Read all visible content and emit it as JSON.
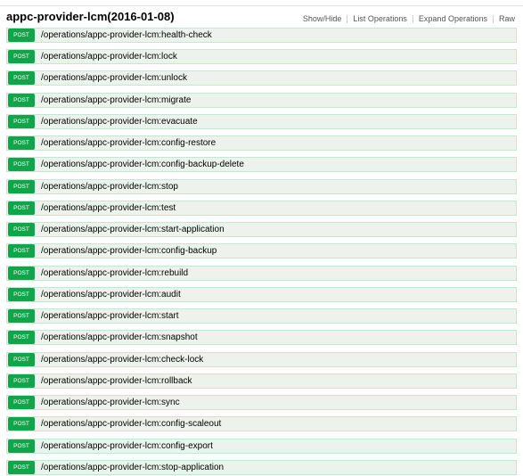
{
  "title": "appc-provider-lcm(2016-01-08)",
  "header_links": [
    "Show/Hide",
    "List Operations",
    "Expand Operations",
    "Raw"
  ],
  "colors": {
    "method_badge": "#10a54a",
    "row_background": "#ebf3ec",
    "row_border": "#c3e8d1"
  },
  "operations": [
    {
      "method": "POST",
      "path": "/operations/appc-provider-lcm:health-check"
    },
    {
      "method": "POST",
      "path": "/operations/appc-provider-lcm:lock"
    },
    {
      "method": "POST",
      "path": "/operations/appc-provider-lcm:unlock"
    },
    {
      "method": "POST",
      "path": "/operations/appc-provider-lcm:migrate"
    },
    {
      "method": "POST",
      "path": "/operations/appc-provider-lcm:evacuate"
    },
    {
      "method": "POST",
      "path": "/operations/appc-provider-lcm:config-restore"
    },
    {
      "method": "POST",
      "path": "/operations/appc-provider-lcm:config-backup-delete"
    },
    {
      "method": "POST",
      "path": "/operations/appc-provider-lcm:stop"
    },
    {
      "method": "POST",
      "path": "/operations/appc-provider-lcm:test"
    },
    {
      "method": "POST",
      "path": "/operations/appc-provider-lcm:start-application"
    },
    {
      "method": "POST",
      "path": "/operations/appc-provider-lcm:config-backup"
    },
    {
      "method": "POST",
      "path": "/operations/appc-provider-lcm:rebuild"
    },
    {
      "method": "POST",
      "path": "/operations/appc-provider-lcm:audit"
    },
    {
      "method": "POST",
      "path": "/operations/appc-provider-lcm:start"
    },
    {
      "method": "POST",
      "path": "/operations/appc-provider-lcm:snapshot"
    },
    {
      "method": "POST",
      "path": "/operations/appc-provider-lcm:check-lock"
    },
    {
      "method": "POST",
      "path": "/operations/appc-provider-lcm:rollback"
    },
    {
      "method": "POST",
      "path": "/operations/appc-provider-lcm:sync"
    },
    {
      "method": "POST",
      "path": "/operations/appc-provider-lcm:config-scaleout"
    },
    {
      "method": "POST",
      "path": "/operations/appc-provider-lcm:config-export"
    },
    {
      "method": "POST",
      "path": "/operations/appc-provider-lcm:stop-application"
    }
  ]
}
